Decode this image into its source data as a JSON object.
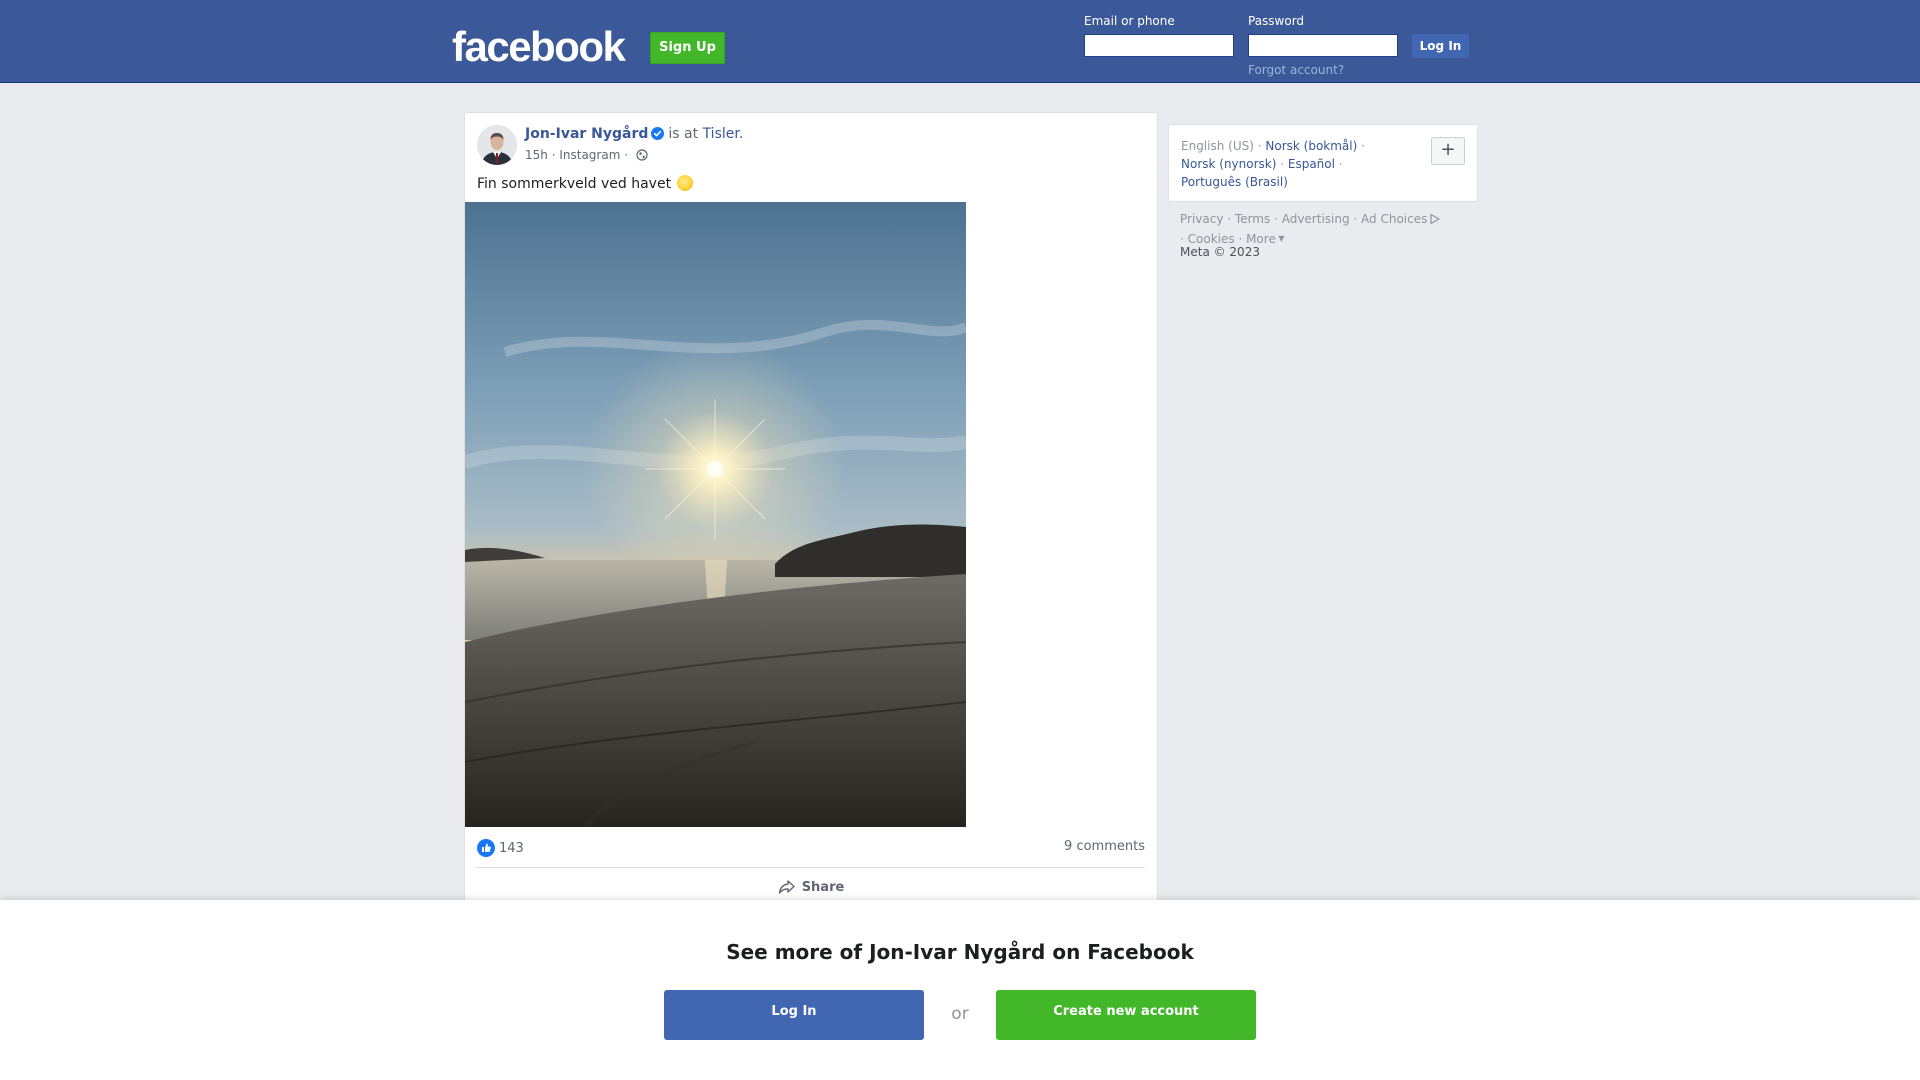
{
  "header": {
    "logo": "facebook",
    "signup_label": "Sign Up",
    "email_label": "Email or phone",
    "password_label": "Password",
    "login_label": "Log In",
    "forgot_label": "Forgot account?"
  },
  "post": {
    "author": "Jon-Ivar Nygård",
    "is_at": "is at",
    "place": "Tisler.",
    "time": "15h",
    "source": "Instagram",
    "text": "Fin sommerkveld ved havet",
    "likes": "143",
    "comments": "9 comments",
    "share_label": "Share",
    "icons": [
      "verified-badge-icon",
      "globe-icon",
      "sun-emoji-icon",
      "like-icon",
      "share-icon"
    ]
  },
  "languages": {
    "current": "English (US)",
    "items": [
      "Norsk (bokmål)",
      "Norsk (nynorsk)",
      "Español",
      "Português (Brasil)"
    ],
    "more_symbol": "+"
  },
  "footer": {
    "links": [
      "Privacy",
      "Terms",
      "Advertising",
      "Ad Choices",
      "Cookies",
      "More"
    ],
    "copyright": "Meta © 2023"
  },
  "overlay": {
    "title": "See more of Jon-Ivar Nygård on Facebook",
    "login_label": "Log In",
    "or_label": "or",
    "create_label": "Create new account"
  },
  "colors": {
    "brand_blue": "#3b5998",
    "button_blue": "#4267b2",
    "link_blue": "#385898",
    "green": "#42b72a",
    "background": "#e9ebee"
  }
}
